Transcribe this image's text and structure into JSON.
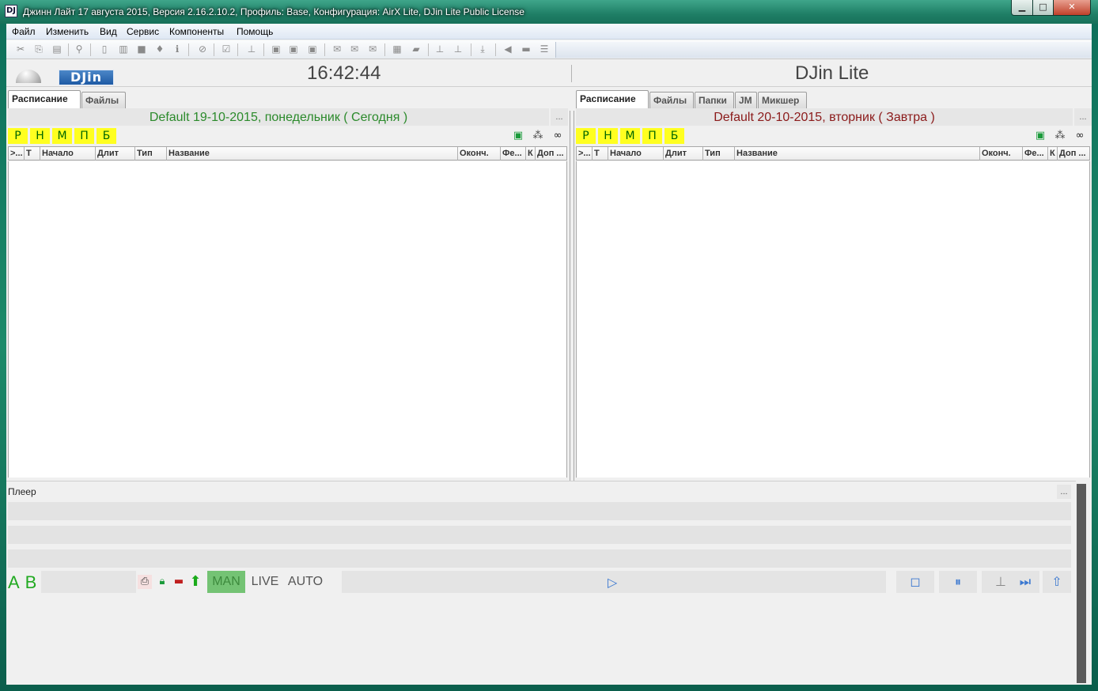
{
  "window": {
    "title": "Джинн Лайт 17 августа 2015, Версия 2.16.2.10.2, Профиль: Base, Конфигурация: AirX Lite, DJin Lite Public License",
    "icon_text": "DJ",
    "min_glyph": "▁",
    "max_glyph": "□",
    "close_glyph": "✕"
  },
  "menu": {
    "items": [
      "Файл",
      "Изменить",
      "Вид",
      "Сервис",
      "Компоненты",
      "Помощь"
    ]
  },
  "toolbar": {
    "icons": [
      "cut-icon",
      "copy-icon",
      "paste-icon",
      "find-icon",
      "new-icon",
      "columns-icon",
      "stop-icon",
      "mic-icon",
      "info-icon",
      "ban-icon",
      "check-icon",
      "insert-icon",
      "block-icon",
      "block2-icon",
      "block3-icon",
      "mail-icon",
      "mail-open-icon",
      "mail-down-icon",
      "save-icon",
      "folder-icon",
      "align-up-icon",
      "align-down-icon",
      "download-icon",
      "speaker-icon",
      "bar-icon",
      "list-icon"
    ]
  },
  "header": {
    "clock": "16:42:44",
    "app_name": "DJin Lite",
    "logo_text": "DJin"
  },
  "left_panel": {
    "tabs": [
      "Расписание",
      "Файлы"
    ],
    "active_tab": 0,
    "schedule_title": "Default 19-10-2015, понедельник ( Сегодня )",
    "title_color": "#2b8a2b",
    "dots": "...",
    "day_buttons": [
      "Р",
      "Н",
      "М",
      "П",
      "Б"
    ],
    "columns": [
      ">...",
      "Т",
      "Начало",
      "Длит",
      "Тип",
      "Название",
      "Оконч.",
      "Фе...",
      "К",
      "Доп ..."
    ]
  },
  "right_panel": {
    "tabs": [
      "Расписание",
      "Файлы",
      "Папки",
      "JM",
      "Микшер"
    ],
    "active_tab": 0,
    "schedule_title": "Default 20-10-2015, вторник ( Завтра )",
    "title_color": "#8b1a1a",
    "dots": "...",
    "day_buttons": [
      "Р",
      "Н",
      "М",
      "П",
      "Б"
    ],
    "columns": [
      ">...",
      "Т",
      "Начало",
      "Длит",
      "Тип",
      "Название",
      "Оконч.",
      "Фе...",
      "К",
      "Доп ..."
    ]
  },
  "player": {
    "label": "Плеер",
    "dots": "...",
    "ab_label": "A B",
    "modes": [
      "MAN",
      "LIVE",
      "AUTO"
    ],
    "active_mode": "MAN",
    "accent_green": "#22aa22",
    "control_blue": "#3b78d0"
  }
}
